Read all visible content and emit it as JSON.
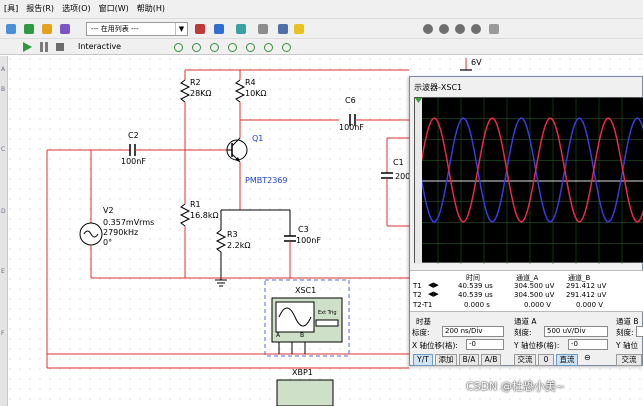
{
  "menubar": {
    "items": [
      "[具]",
      "报告(R)",
      "选项(O)",
      "窗口(W)",
      "帮助(H)"
    ]
  },
  "toolbar1": {
    "combo_value": "--- 在用列表 ---"
  },
  "toolbar2": {
    "mode_label": "Interactive"
  },
  "ruler": {
    "letters": [
      "A",
      "B",
      "C",
      "D",
      "E",
      "F"
    ]
  },
  "circuit": {
    "vcc": "6V",
    "r2": {
      "name": "R2",
      "value": "28KΩ"
    },
    "r4": {
      "name": "R4",
      "value": "10KΩ"
    },
    "c6": {
      "name": "C6",
      "value": "100nF"
    },
    "c2": {
      "name": "C2",
      "value": "100nF"
    },
    "q1": {
      "name": "Q1",
      "model": "PMBT2369"
    },
    "c1": {
      "name": "C1",
      "value": "200"
    },
    "v2": {
      "name": "V2",
      "amplitude": "0.357mVrms",
      "frequency": "2790kHz",
      "phase": "0°"
    },
    "r1": {
      "name": "R1",
      "value": "16.8kΩ"
    },
    "r3": {
      "name": "R3",
      "value": "2.2kΩ"
    },
    "c3": {
      "name": "C3",
      "value": "100nF"
    },
    "xsc1": {
      "name": "XSC1",
      "ext_trig": "Ext Trig",
      "pin_a": "A",
      "pin_b": "B"
    },
    "xbp1": {
      "name": "XBP1"
    }
  },
  "scope": {
    "title": "示波器-XSC1",
    "cursor_table": {
      "headers": [
        "时间",
        "通道_A",
        "通道_B"
      ],
      "rows": [
        {
          "label": "T1",
          "time": "40.539 us",
          "ch_a": "304.500 uV",
          "ch_b": "291.412 uV"
        },
        {
          "label": "T2",
          "time": "40.539 us",
          "ch_a": "304.500 uV",
          "ch_b": "291.412 uV"
        },
        {
          "label": "T2-T1",
          "time": "0.000 s",
          "ch_a": "0.000 V",
          "ch_b": "0.000 V"
        }
      ]
    },
    "timebase": {
      "heading": "时基",
      "scale_label": "标度:",
      "scale_value": "200 ns/Div",
      "xpos_label": "X 轴位移(格):",
      "xpos_value": "-0",
      "buttons": [
        "Y/T",
        "添加",
        "B/A",
        "A/B"
      ]
    },
    "channel_a": {
      "heading": "通道 A",
      "scale_label": "刻度:",
      "scale_value": "500 uV/Div",
      "ypos_label": "Y 轴位移(格):",
      "ypos_value": "-0",
      "coupling": [
        "交流",
        "0",
        "直流"
      ]
    },
    "channel_b": {
      "heading": "通道 B",
      "scale_label": "刻度:",
      "ypos_label": "Y 轴位",
      "coupling_first": "交流"
    },
    "trace_colors": {
      "channel_a": "#e8294a",
      "channel_b": "#3a3ae0",
      "grid": "#2a6a2a"
    }
  },
  "watermark": "CSDN @杜恐小美~"
}
